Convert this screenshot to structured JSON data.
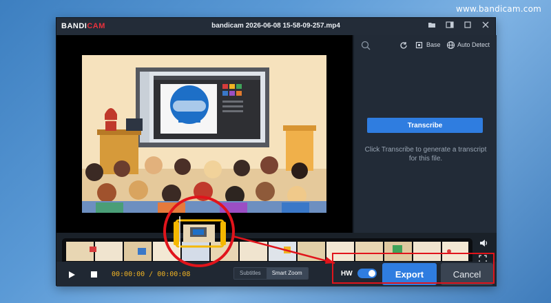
{
  "watermark": "www.bandicam.com",
  "window": {
    "brand_main": "BANDI",
    "brand_accent": "CAM",
    "title": "bandicam 2026-06-08 15-58-09-257.mp4",
    "buttons": [
      "folder-icon",
      "split-view-icon",
      "maximize-icon",
      "close-icon"
    ]
  },
  "panel": {
    "model_label": "Base",
    "language_label": "Auto Detect",
    "transcribe_label": "Transcribe",
    "hint": "Click Transcribe to generate a transcript for this file."
  },
  "controls": {
    "timecode": "00:00:00 / 00:00:08",
    "modes": [
      {
        "label": "Subtitles",
        "active": false
      },
      {
        "label": "Smart Zoom",
        "active": true
      }
    ],
    "hw_label": "HW",
    "hw_enabled": true,
    "export_label": "Export",
    "cancel_label": "Cancel"
  },
  "colors": {
    "accent": "#2f7de0",
    "timecode": "#f0b323",
    "brand_red": "#e8313c",
    "callout": "#e1141b",
    "selection": "#f5b800"
  }
}
